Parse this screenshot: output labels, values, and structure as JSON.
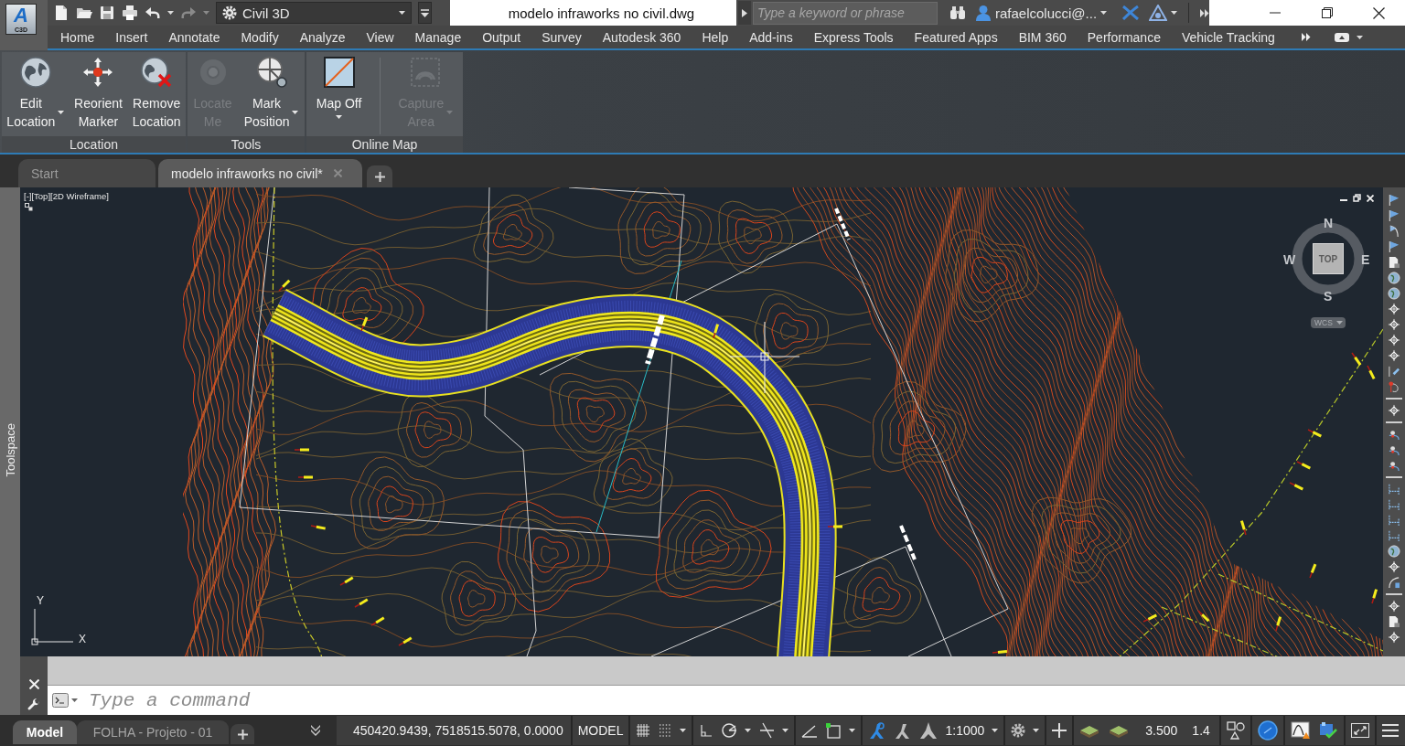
{
  "app_logo": {
    "letter": "A",
    "badge": "C3D"
  },
  "title_bar": {
    "workspace": "Civil 3D",
    "document_title": "modelo infraworks no civil.dwg",
    "search": {
      "placeholder": "Type a keyword or phrase"
    },
    "user": "rafaelcolucci@..."
  },
  "ribbon_tabs": [
    "Home",
    "Insert",
    "Annotate",
    "Modify",
    "Analyze",
    "View",
    "Manage",
    "Output",
    "Survey",
    "Autodesk 360",
    "Help",
    "Add-ins",
    "Express Tools",
    "Featured Apps",
    "BIM 360",
    "Performance",
    "Vehicle Tracking"
  ],
  "ribbon_panels": [
    {
      "title": "Location",
      "buttons": [
        {
          "label": "Edit\nLocation",
          "dropdown": true,
          "disabled": false
        },
        {
          "label": "Reorient\nMarker",
          "dropdown": false,
          "disabled": false
        },
        {
          "label": "Remove\nLocation",
          "dropdown": false,
          "disabled": false
        }
      ]
    },
    {
      "title": "Tools",
      "buttons": [
        {
          "label": "Locate\nMe",
          "dropdown": false,
          "disabled": true
        },
        {
          "label": "Mark\nPosition",
          "dropdown": true,
          "disabled": false
        }
      ]
    },
    {
      "title": "Online Map",
      "buttons": [
        {
          "label": "Map Off",
          "dropdown": true,
          "disabled": false
        },
        {
          "label": "Capture\nArea",
          "dropdown": true,
          "disabled": true
        }
      ]
    }
  ],
  "file_tabs": [
    {
      "label": "Start",
      "selected": false
    },
    {
      "label": "modelo infraworks no civil*",
      "selected": true
    }
  ],
  "toolspace": {
    "label": "Toolspace"
  },
  "viewport": {
    "label": "[-][Top][2D Wireframe]",
    "viewcube": {
      "north": "N",
      "east": "E",
      "south": "S",
      "west": "W",
      "face": "TOP",
      "coordinate_system": "WCS"
    },
    "ucs": {
      "y": "Y",
      "x": "X"
    }
  },
  "command_line": {
    "placeholder": "Type a command"
  },
  "status_bar": {
    "layout_tabs": [
      {
        "label": "Model",
        "selected": true
      },
      {
        "label": "FOLHA - Projeto - 01",
        "selected": false
      }
    ],
    "coordinates": "450420.9439, 7518515.5078, 0.0000",
    "space": "MODEL",
    "annotation_scale": "1:1000",
    "value_1": "3.500",
    "value_2": "1.4"
  }
}
